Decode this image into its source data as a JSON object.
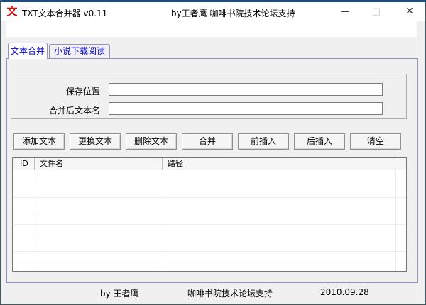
{
  "window": {
    "icon_glyph": "文",
    "title": "TXT文本合并器 v0.11",
    "subtitle": "by王者鹰 咖啡书院技术论坛支持",
    "controls": {
      "minimize_glyph": "—",
      "maximize_glyph": "□",
      "close_glyph": "✕"
    }
  },
  "tabs": [
    {
      "label": "文本合并",
      "active": true
    },
    {
      "label": "小说下载阅读",
      "active": false
    }
  ],
  "form": {
    "fields": [
      {
        "label": "保存位置",
        "value": ""
      },
      {
        "label": "合并后文本名",
        "value": ""
      }
    ]
  },
  "buttons": [
    "添加文本",
    "更换文本",
    "删除文本",
    "合并",
    "前插入",
    "后插入",
    "清空"
  ],
  "table": {
    "columns": [
      "ID",
      "文件名",
      "路径"
    ],
    "rows": []
  },
  "footer": {
    "author": "by 王者鹰",
    "support": "咖啡书院技术论坛支持",
    "date": "2010.09.28"
  },
  "colors": {
    "accent_top": "#1d4d7c",
    "tab_text": "#0000cc",
    "page_border": "#8f92c8",
    "icon_red": "#cc1111"
  }
}
